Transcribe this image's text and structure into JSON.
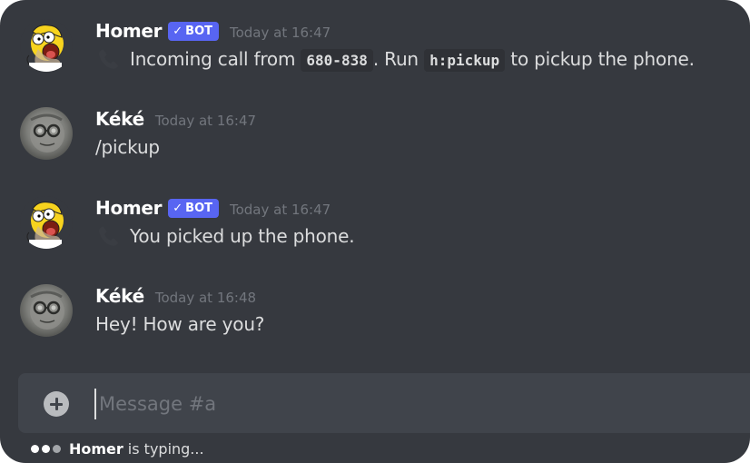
{
  "messages": [
    {
      "author": "Homer",
      "bot": true,
      "bot_tag": "BOT",
      "bot_check": "✓",
      "timestamp": "Today at 16:47",
      "avatar_icon": "homer-avatar",
      "content": {
        "icon": "phone-icon",
        "text_1": "Incoming call from ",
        "code_1": "680-838",
        "text_2": ". Run ",
        "code_2": "h:pickup",
        "text_3": " to pickup the phone."
      }
    },
    {
      "author": "Kéké",
      "bot": false,
      "timestamp": "Today at 16:47",
      "avatar_icon": "keke-avatar",
      "content": {
        "text": "/pickup"
      }
    },
    {
      "author": "Homer",
      "bot": true,
      "bot_tag": "BOT",
      "bot_check": "✓",
      "timestamp": "Today at 16:47",
      "avatar_icon": "homer-avatar",
      "content": {
        "icon": "phone-icon",
        "text": "You picked up the phone."
      }
    },
    {
      "author": "Kéké",
      "bot": false,
      "timestamp": "Today at 16:48",
      "avatar_icon": "keke-avatar",
      "content": {
        "text": "Hey! How are you?"
      }
    }
  ],
  "composer": {
    "placeholder": "Message #a",
    "value": "",
    "add_icon": "plus-circle-icon"
  },
  "typing": {
    "name": "Homer",
    "text": "is typing..."
  },
  "colors": {
    "background": "#36393f",
    "composer": "#40444b",
    "bot_tag": "#5865f2",
    "username": "#ffffff",
    "timestamp": "#72767d",
    "text": "#dcddde"
  }
}
